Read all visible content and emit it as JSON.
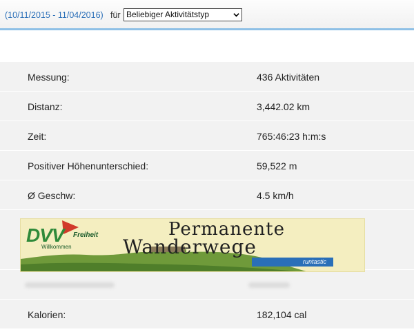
{
  "header": {
    "date_range": "(10/11/2015 - 11/04/2016)",
    "fuer_label": "für",
    "activity_select": "Beliebiger Aktivitätstyp"
  },
  "stats": [
    {
      "label": "Messung:",
      "value": "436 Aktivitäten"
    },
    {
      "label": "Distanz:",
      "value": "3,442.02 km"
    },
    {
      "label": "Zeit:",
      "value": "765:46:23 h:m:s"
    },
    {
      "label": "Positiver Höhenunterschied:",
      "value": "59,522 m"
    },
    {
      "label": "Ø Geschw:",
      "value": "4.5 km/h"
    }
  ],
  "banner": {
    "logo_dvv": "DVV",
    "logo_freiheit": "Freiheit",
    "logo_willkommen": "Willkommen",
    "title_line1": "Permanente",
    "title_line2": "Wanderwege",
    "brand": "runtastic",
    "colors": {
      "background": "#f4eec0",
      "hill": "#6f9a3a",
      "brand_blue": "#2a6fb8"
    }
  },
  "footer_stat": {
    "label": "Kalorien:",
    "value": "182,104 cal"
  }
}
